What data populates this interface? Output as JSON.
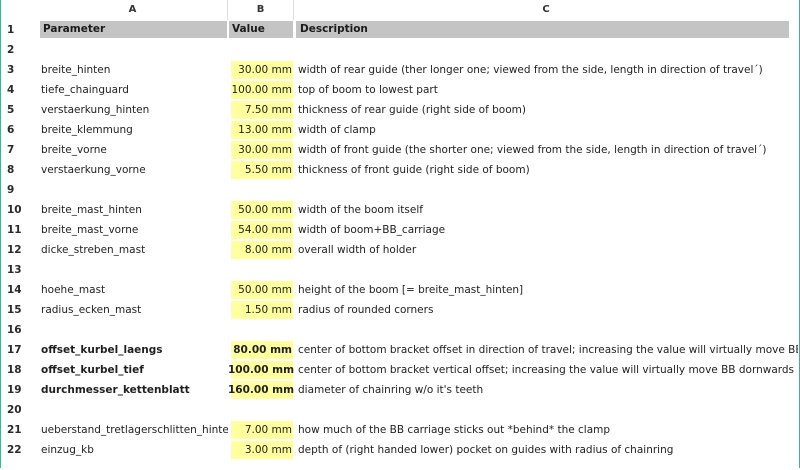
{
  "columns": [
    "A",
    "B",
    "C"
  ],
  "header": {
    "row": "1",
    "param": "Parameter",
    "value": "Value",
    "desc": "Description"
  },
  "rows": [
    {
      "n": "2",
      "param": "",
      "value": "",
      "desc": "",
      "bold": false
    },
    {
      "n": "3",
      "param": "breite_hinten",
      "value": "30.00 mm",
      "desc": "width of rear guide (ther longer one; viewed from the side, length in direction of travel´)",
      "bold": false
    },
    {
      "n": "4",
      "param": "tiefe_chainguard",
      "value": "100.00 mm",
      "desc": "top of boom to lowest part",
      "bold": false
    },
    {
      "n": "5",
      "param": "verstaerkung_hinten",
      "value": "7.50 mm",
      "desc": "thickness of rear guide (right side of boom)",
      "bold": false
    },
    {
      "n": "6",
      "param": "breite_klemmung",
      "value": "13.00 mm",
      "desc": "width of clamp",
      "bold": false
    },
    {
      "n": "7",
      "param": "breite_vorne",
      "value": "30.00 mm",
      "desc": "width of front guide (the shorter one; viewed from the side, length in direction of travel´)",
      "bold": false
    },
    {
      "n": "8",
      "param": "verstaerkung_vorne",
      "value": "5.50 mm",
      "desc": "thickness of front guide (right side of boom)",
      "bold": false
    },
    {
      "n": "9",
      "param": "",
      "value": "",
      "desc": "",
      "bold": false
    },
    {
      "n": "10",
      "param": "breite_mast_hinten",
      "value": "50.00 mm",
      "desc": "width of the boom itself",
      "bold": false
    },
    {
      "n": "11",
      "param": "breite_mast_vorne",
      "value": "54.00 mm",
      "desc": "width of boom+BB_carriage",
      "bold": false
    },
    {
      "n": "12",
      "param": "dicke_streben_mast",
      "value": "8.00 mm",
      "desc": "overall width of holder",
      "bold": false
    },
    {
      "n": "13",
      "param": "",
      "value": "",
      "desc": "",
      "bold": false
    },
    {
      "n": "14",
      "param": "hoehe_mast",
      "value": "50.00 mm",
      "desc": "height of the boom [= breite_mast_hinten]",
      "bold": false
    },
    {
      "n": "15",
      "param": "radius_ecken_mast",
      "value": "1.50 mm",
      "desc": "radius of rounded corners",
      "bold": false
    },
    {
      "n": "16",
      "param": "",
      "value": "",
      "desc": "",
      "bold": false
    },
    {
      "n": "17",
      "param": "offset_kurbel_laengs",
      "value": "80.00 mm",
      "desc": "center of bottom bracket offset in direction of travel; increasing the value will virtually move BB forwards",
      "bold": true
    },
    {
      "n": "18",
      "param": "offset_kurbel_tief",
      "value": "100.00 mm",
      "desc": "center of bottom bracket vertical offset; increasing the value will virtually move BB dornwards",
      "bold": true
    },
    {
      "n": "19",
      "param": "durchmesser_kettenblatt",
      "value": "160.00 mm",
      "desc": "diameter of chainring w/o it's teeth",
      "bold": true
    },
    {
      "n": "20",
      "param": "",
      "value": "",
      "desc": "",
      "bold": false
    },
    {
      "n": "21",
      "param": "ueberstand_tretlagerschlitten_hinten",
      "value": "7.00 mm",
      "desc": "how much of the BB carriage sticks out *behind* the clamp",
      "bold": false
    },
    {
      "n": "22",
      "param": "einzug_kb",
      "value": "3.00 mm",
      "desc": "depth of (right handed lower) pocket on guides with radius of chainring",
      "bold": false
    }
  ]
}
